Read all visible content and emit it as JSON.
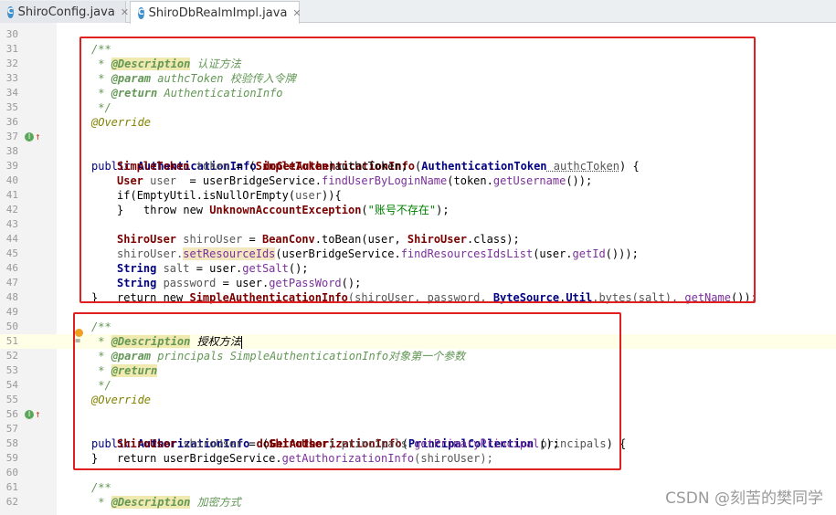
{
  "tabs": [
    {
      "label": "ShiroConfig.java",
      "active": false
    },
    {
      "label": "ShiroDbRealmImpl.java",
      "active": true
    }
  ],
  "icons": {
    "file": "java-class-icon",
    "close": "close-icon"
  },
  "colors": {
    "highlight_box": "#e02020"
  },
  "gutter": {
    "line_numbers": [
      "30",
      "31",
      "32",
      "33",
      "34",
      "35",
      "36",
      "37",
      "38",
      "39",
      "40",
      "41",
      "42",
      "43",
      "44",
      "45",
      "46",
      "47",
      "48",
      "49",
      "50",
      "51",
      "52",
      "53",
      "54",
      "55",
      "56",
      "57",
      "58",
      "59",
      "60",
      "61",
      "62"
    ]
  },
  "code": {
    "l31": "/**",
    "l32_tag": "@Description",
    "l32_text": " 认证方法",
    "l33_tag": "@param",
    "l33_text": " authcToken 校验传入令牌",
    "l34_tag": "@return",
    "l34_text": " AuthenticationInfo",
    "l35": " */",
    "l36": "@Override",
    "l37_a": "public ",
    "l37_b": "AuthenticationInfo",
    "l37_c": " doGetAuthenticationInfo",
    "l37_d": "(",
    "l37_e": "AuthenticationToken",
    "l37_f": " authcToken",
    "l37_g": ") {",
    "l38_a": "SimpleToken",
    "l38_b": " token",
    "l38_c": " = (",
    "l38_d": "SimpleToken",
    "l38_e": ")authcToken;",
    "l39_a": "User",
    "l39_b": " user",
    "l39_c": "  = userBridgeService.",
    "l39_d": "findUserByLoginName",
    "l39_e": "(token.",
    "l39_f": "getUsername",
    "l39_g": "());",
    "l40_a": "if(",
    "l40_b": "EmptyUtil",
    "l40_c": ".isNullOrEmpty(",
    "l40_d": "user",
    "l40_e": ")){",
    "l41_a": "throw new ",
    "l41_b": "UnknownAccountException",
    "l41_c": "(",
    "l41_d": "\"账号不存在\"",
    "l41_e": ");",
    "l42": "}",
    "l43_a": "ShiroUser",
    "l43_b": " shiroUser",
    "l43_c": " = ",
    "l43_d": "BeanConv",
    "l43_e": ".toBean(user, ",
    "l43_f": "ShiroUser",
    "l43_g": ".class);",
    "l44_a": "shiroUser.",
    "l44_b": "setResourceIds",
    "l44_c": "(userBridgeService.",
    "l44_d": "findResourcesIdsList",
    "l44_e": "(user.",
    "l44_f": "getId",
    "l44_g": "()));",
    "l45_a": "String",
    "l45_b": " salt",
    "l45_c": " = user.",
    "l45_d": "getSalt",
    "l45_e": "();",
    "l46_a": "String",
    "l46_b": " password",
    "l46_c": " = user.",
    "l46_d": "getPassWord",
    "l46_e": "();",
    "l47_a": "return new ",
    "l47_b": "SimpleAuthenticationInfo",
    "l47_c": "(shiroUser, password, ",
    "l47_d": "ByteSource",
    "l47_e": ".",
    "l47_f": "Util",
    "l47_g": ".bytes(salt), ",
    "l47_h": "getName",
    "l47_i": "());",
    "l48": "}",
    "l50": "/**",
    "l51_tag": "@Description",
    "l51_text": " 授权方法",
    "l52_tag": "@param",
    "l52_text": " principals SimpleAuthenticationInfo对象第一个参数",
    "l53_tag": "@return",
    "l54": " */",
    "l55": "@Override",
    "l56_a": "public ",
    "l56_b": "AuthorizationInfo",
    "l56_c": " doGetAuthorizationInfo",
    "l56_d": "(",
    "l56_e": "PrincipalCollection",
    "l56_f": " principals",
    "l56_g": ") {",
    "l57_a": "ShiroUser",
    "l57_b": " shiroUser",
    "l57_c": " = (",
    "l57_d": "ShiroUser",
    "l57_e": ") principals.",
    "l57_f": "getPrimaryPrincipal",
    "l57_g": "();",
    "l58_a": "return ",
    "l58_b": "userBridgeService.",
    "l58_c": "getAuthorizationInfo",
    "l58_d": "(shiroUser);",
    "l59": "}",
    "l61": "/**",
    "l62_tag": "@Description",
    "l62_text": " 加密方式"
  },
  "watermark": "CSDN @刻苦的樊同学"
}
